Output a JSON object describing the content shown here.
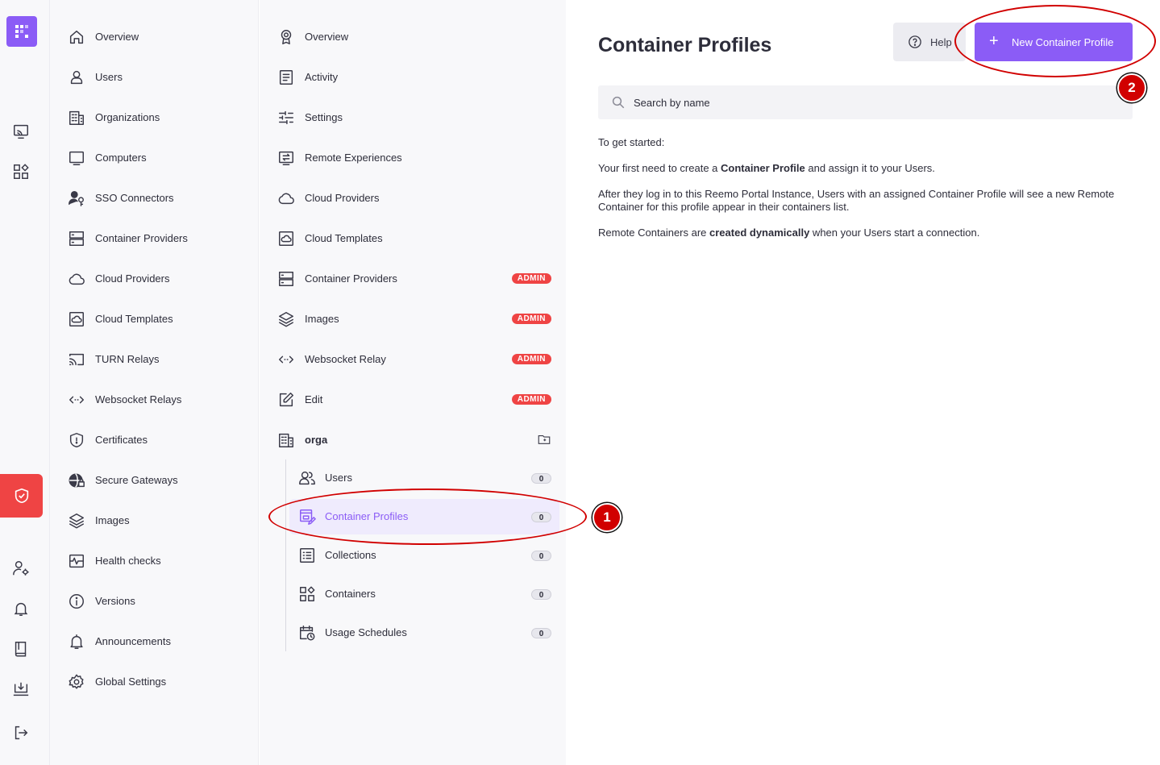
{
  "rail": {
    "logo": "reemo-logo",
    "icons": [
      "cast-icon",
      "apps-icon",
      "shield-check-icon",
      "user-settings-icon",
      "bell-icon",
      "book-icon",
      "download-screen-icon",
      "logout-icon"
    ]
  },
  "col1": {
    "items": [
      {
        "label": "Overview",
        "icon": "home-icon"
      },
      {
        "label": "Users",
        "icon": "user-icon"
      },
      {
        "label": "Organizations",
        "icon": "building-icon"
      },
      {
        "label": "Computers",
        "icon": "monitor-icon"
      },
      {
        "label": "SSO Connectors",
        "icon": "user-key-icon"
      },
      {
        "label": "Container Providers",
        "icon": "server-icon"
      },
      {
        "label": "Cloud Providers",
        "icon": "cloud-icon"
      },
      {
        "label": "Cloud Templates",
        "icon": "cloud-template-icon"
      },
      {
        "label": "TURN Relays",
        "icon": "cast-icon"
      },
      {
        "label": "Websocket Relays",
        "icon": "code-icon"
      },
      {
        "label": "Certificates",
        "icon": "shield-icon"
      },
      {
        "label": "Secure Gateways",
        "icon": "globe-lock-icon"
      },
      {
        "label": "Images",
        "icon": "layers-icon"
      },
      {
        "label": "Health checks",
        "icon": "pulse-icon"
      },
      {
        "label": "Versions",
        "icon": "info-icon"
      },
      {
        "label": "Announcements",
        "icon": "bell-icon"
      },
      {
        "label": "Global Settings",
        "icon": "gear-icon"
      }
    ]
  },
  "col2": {
    "items": [
      {
        "label": "Overview",
        "icon": "award-icon",
        "badge": ""
      },
      {
        "label": "Activity",
        "icon": "document-icon",
        "badge": ""
      },
      {
        "label": "Settings",
        "icon": "sliders-icon",
        "badge": ""
      },
      {
        "label": "Remote Experiences",
        "icon": "remote-icon",
        "badge": ""
      },
      {
        "label": "Cloud Providers",
        "icon": "cloud-icon",
        "badge": ""
      },
      {
        "label": "Cloud Templates",
        "icon": "cloud-template-icon",
        "badge": ""
      },
      {
        "label": "Container Providers",
        "icon": "server-icon",
        "badge": "ADMIN"
      },
      {
        "label": "Images",
        "icon": "layers-icon",
        "badge": "ADMIN"
      },
      {
        "label": "Websocket Relay",
        "icon": "code-icon",
        "badge": "ADMIN"
      },
      {
        "label": "Edit",
        "icon": "edit-icon",
        "badge": "ADMIN"
      }
    ],
    "org": {
      "label": "orga",
      "icon": "building-icon",
      "action_icon": "folder-add-icon"
    },
    "sub_items": [
      {
        "label": "Users",
        "icon": "users-icon",
        "count": "0",
        "active": false
      },
      {
        "label": "Container Profiles",
        "icon": "container-profile-icon",
        "count": "0",
        "active": true
      },
      {
        "label": "Collections",
        "icon": "list-icon",
        "count": "0",
        "active": false
      },
      {
        "label": "Containers",
        "icon": "apps-icon",
        "count": "0",
        "active": false
      },
      {
        "label": "Usage Schedules",
        "icon": "calendar-clock-icon",
        "count": "0",
        "active": false
      }
    ]
  },
  "main": {
    "title": "Container Profiles",
    "help_label": "Help",
    "new_label": "New Container Profile",
    "search_placeholder": "Search by name",
    "intro": {
      "p1": "To get started:",
      "p2_a": "Your first need to create a ",
      "p2_b": "Container Profile",
      "p2_c": " and assign it to your Users.",
      "p3": "After they log in to this Reemo Portal Instance, Users with an assigned Container Profile will see a new Remote Container for this profile appear in their containers list.",
      "p4_a": "Remote Containers are ",
      "p4_b": "created dynamically",
      "p4_c": " when your Users start a connection."
    }
  },
  "annotations": {
    "marker1": "1",
    "marker2": "2",
    "color": "#d10000"
  },
  "colors": {
    "accent": "#8b5cf6",
    "danger": "#ef4444",
    "sidebar_bg": "#f8f8fa"
  }
}
